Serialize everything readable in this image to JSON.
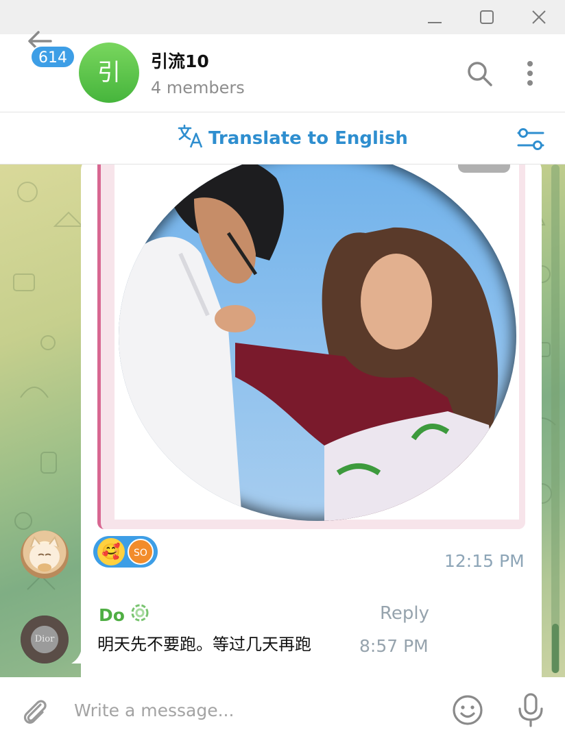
{
  "window": {
    "buttons": [
      "minimize-icon",
      "maximize-icon",
      "close-icon"
    ]
  },
  "header": {
    "unread_count": "614",
    "avatar_letter": "引",
    "title": "引流10",
    "subtitle": "4 members"
  },
  "translate_bar": {
    "label": "Translate to English",
    "accent": "#2e8ecf"
  },
  "messages": [
    {
      "type": "photo",
      "reactions": [
        {
          "emoji": "🥰"
        },
        {
          "avatar_text": "SO"
        }
      ],
      "time": "12:15 PM"
    },
    {
      "type": "text",
      "sender": "Do",
      "reply_label": "Reply",
      "text": "明天先不要跑。等过几天再跑",
      "time": "8:57 PM",
      "avatar_text": "Dior"
    }
  ],
  "composer": {
    "placeholder": "Write a message..."
  },
  "colors": {
    "badge": "#3d9ee6",
    "sender_name": "#4fae43",
    "accent_pink": "#d86791"
  }
}
